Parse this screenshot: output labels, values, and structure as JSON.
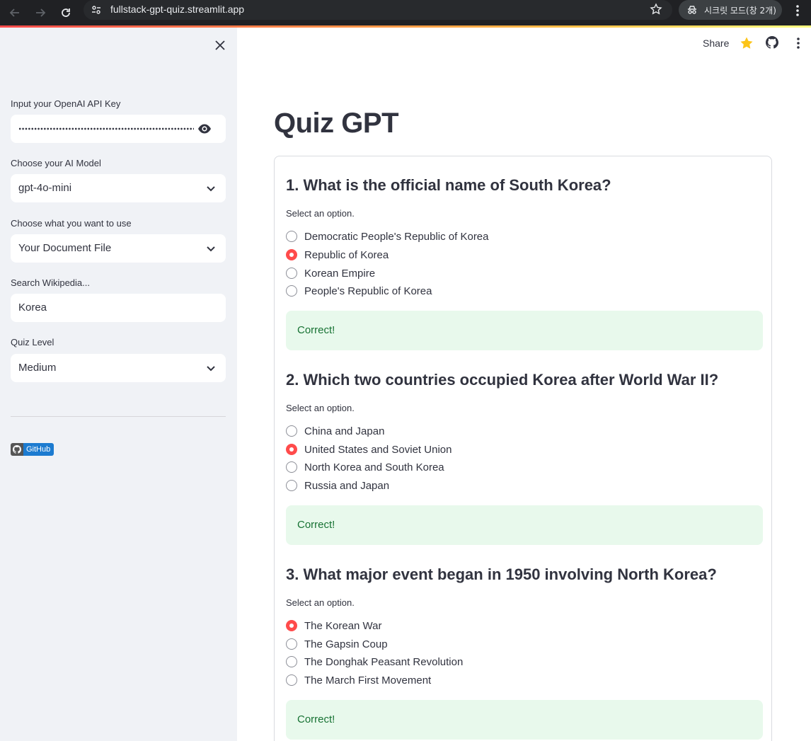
{
  "browser": {
    "url": "fullstack-gpt-quiz.streamlit.app",
    "incognito_label": "시크릿 모드(창 2개)"
  },
  "sidebar": {
    "api_key": {
      "label": "Input your OpenAI API Key",
      "masked": true
    },
    "model": {
      "label": "Choose your AI Model",
      "value": "gpt-4o-mini"
    },
    "source": {
      "label": "Choose what you want to use",
      "value": "Your Document File"
    },
    "search": {
      "label": "Search Wikipedia...",
      "value": "Korea"
    },
    "level": {
      "label": "Quiz Level",
      "value": "Medium"
    },
    "github_badge": "GitHub"
  },
  "header": {
    "share_label": "Share",
    "icons": [
      "star-icon",
      "github-icon",
      "more-vert-icon"
    ]
  },
  "main": {
    "title": "Quiz GPT",
    "select_prompt": "Select an option.",
    "questions": [
      {
        "title": "1. What is the official name of South Korea?",
        "options": [
          "Democratic People's Republic of Korea",
          "Republic of Korea",
          "Korean Empire",
          "People's Republic of Korea"
        ],
        "selected_index": 1,
        "result": "Correct!"
      },
      {
        "title": "2. Which two countries occupied Korea after World War II?",
        "options": [
          "China and Japan",
          "United States and Soviet Union",
          "North Korea and South Korea",
          "Russia and Japan"
        ],
        "selected_index": 1,
        "result": "Correct!"
      },
      {
        "title": "3. What major event began in 1950 involving North Korea?",
        "options": [
          "The Korean War",
          "The Gapsin Coup",
          "The Donghak Peasant Revolution",
          "The March First Movement"
        ],
        "selected_index": 0,
        "result": "Correct!"
      }
    ]
  },
  "colors": {
    "accent": "#ff4b4b",
    "sidebar_bg": "#f0f2f6",
    "success_bg": "#e8f9ec",
    "success_text": "#177233",
    "text": "#31333f"
  }
}
